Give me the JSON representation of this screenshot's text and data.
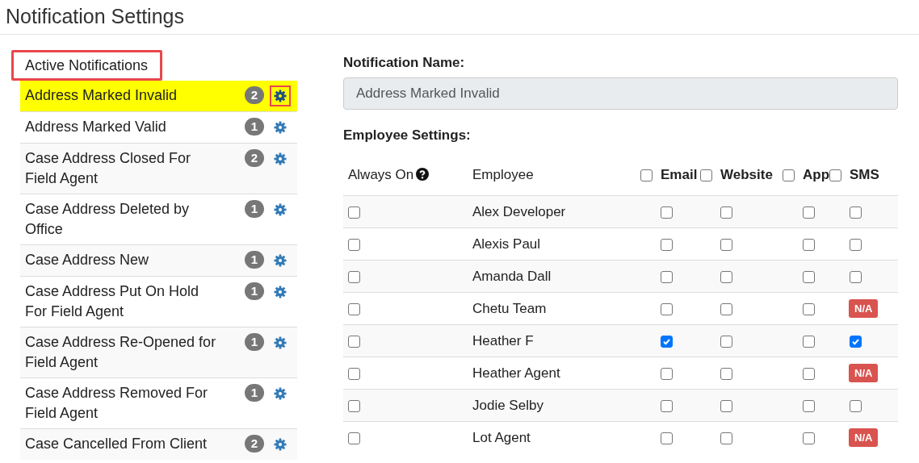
{
  "page": {
    "title": "Notification Settings"
  },
  "sidebar": {
    "heading": {
      "label": "Active Notifications",
      "annotated": true
    },
    "items": [
      {
        "label": "Address Marked Invalid",
        "count": "2",
        "selected": true,
        "gear_annotated": true
      },
      {
        "label": "Address Marked Valid",
        "count": "1",
        "selected": false,
        "gear_annotated": false
      },
      {
        "label": "Case Address Closed For Field Agent",
        "count": "2",
        "selected": false,
        "gear_annotated": false
      },
      {
        "label": "Case Address Deleted by Office",
        "count": "1",
        "selected": false,
        "gear_annotated": false
      },
      {
        "label": "Case Address New",
        "count": "1",
        "selected": false,
        "gear_annotated": false
      },
      {
        "label": "Case Address Put On Hold For Field Agent",
        "count": "1",
        "selected": false,
        "gear_annotated": false
      },
      {
        "label": "Case Address Re-Opened for Field Agent",
        "count": "1",
        "selected": false,
        "gear_annotated": false
      },
      {
        "label": "Case Address Removed For Field Agent",
        "count": "1",
        "selected": false,
        "gear_annotated": false
      },
      {
        "label": "Case Cancelled From Client",
        "count": "2",
        "selected": false,
        "gear_annotated": false
      }
    ]
  },
  "form": {
    "name_label": "Notification Name:",
    "name_value": "Address Marked Invalid",
    "settings_label": "Employee Settings:"
  },
  "table": {
    "columns": [
      {
        "kind": "help",
        "label": "Always On"
      },
      {
        "kind": "plain",
        "label": "Employee"
      },
      {
        "kind": "check",
        "label": "Email",
        "checked": false
      },
      {
        "kind": "check",
        "label": "Website",
        "checked": false
      },
      {
        "kind": "check",
        "label": "App",
        "checked": false
      },
      {
        "kind": "check",
        "label": "SMS",
        "checked": false
      }
    ],
    "rows": [
      {
        "always_on": false,
        "employee": "Alex Developer",
        "email": false,
        "website": false,
        "app": false,
        "sms": {
          "kind": "checkbox",
          "checked": false
        }
      },
      {
        "always_on": false,
        "employee": "Alexis Paul",
        "email": false,
        "website": false,
        "app": false,
        "sms": {
          "kind": "checkbox",
          "checked": false
        }
      },
      {
        "always_on": false,
        "employee": "Amanda Dall",
        "email": false,
        "website": false,
        "app": false,
        "sms": {
          "kind": "checkbox",
          "checked": false
        }
      },
      {
        "always_on": false,
        "employee": "Chetu Team",
        "email": false,
        "website": false,
        "app": false,
        "sms": {
          "kind": "badge",
          "text": "N/A"
        }
      },
      {
        "always_on": false,
        "employee": "Heather F",
        "email": true,
        "website": false,
        "app": false,
        "sms": {
          "kind": "checkbox",
          "checked": true
        }
      },
      {
        "always_on": false,
        "employee": "Heather Agent",
        "email": false,
        "website": false,
        "app": false,
        "sms": {
          "kind": "badge",
          "text": "N/A"
        }
      },
      {
        "always_on": false,
        "employee": "Jodie Selby",
        "email": false,
        "website": false,
        "app": false,
        "sms": {
          "kind": "checkbox",
          "checked": false
        }
      },
      {
        "always_on": false,
        "employee": "Lot Agent",
        "email": false,
        "website": false,
        "app": false,
        "sms": {
          "kind": "badge",
          "text": "N/A"
        }
      }
    ]
  }
}
